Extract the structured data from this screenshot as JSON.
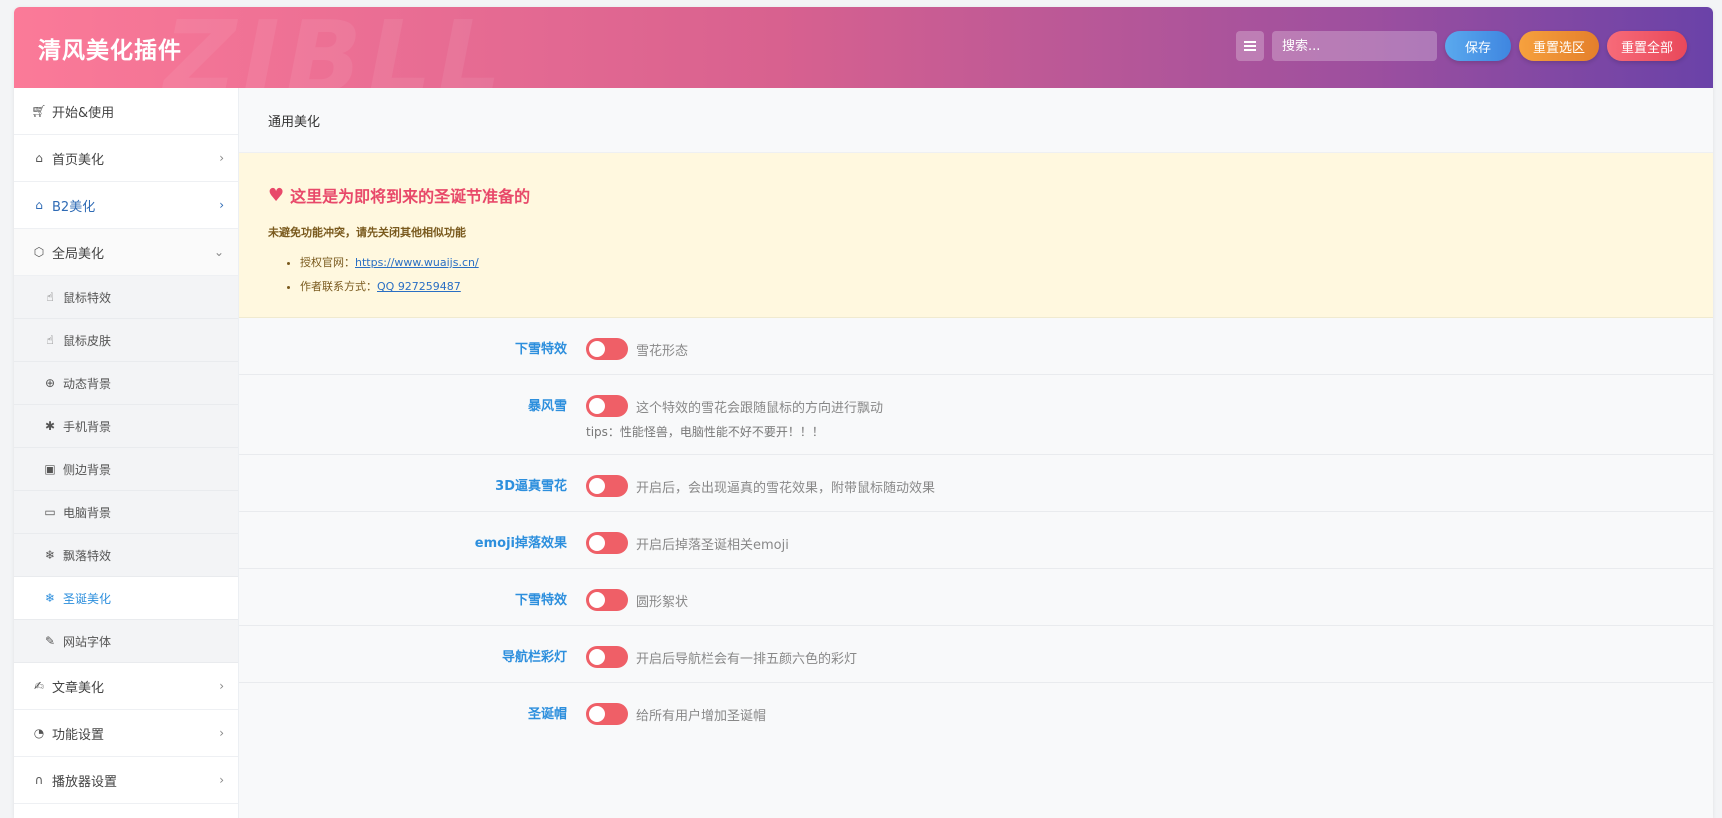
{
  "header": {
    "brand": "清风美化插件",
    "watermark": "ZIBLL",
    "search_placeholder": "搜索...",
    "save_label": "保存",
    "reset_section_label": "重置选区",
    "reset_all_label": "重置全部",
    "gradient": [
      "#fb7a98",
      "#6a42a8"
    ]
  },
  "sidebar": {
    "items": [
      {
        "label": "开始&使用",
        "icon": "cart-icon"
      },
      {
        "label": "首页美化",
        "icon": "home-icon"
      },
      {
        "label": "B2美化",
        "icon": "home-icon"
      },
      {
        "label": "全局美化",
        "icon": "cube-icon"
      }
    ],
    "sub_items": [
      {
        "label": "鼠标特效",
        "icon": "hand-pointer-icon"
      },
      {
        "label": "鼠标皮肤",
        "icon": "hand-pointer-icon"
      },
      {
        "label": "动态背景",
        "icon": "lifebuoy-icon"
      },
      {
        "label": "手机背景",
        "icon": "android-icon"
      },
      {
        "label": "侧边背景",
        "icon": "image-icon"
      },
      {
        "label": "电脑背景",
        "icon": "monitor-icon"
      },
      {
        "label": "飘落特效",
        "icon": "snowflake-icon"
      },
      {
        "label": "圣诞美化",
        "icon": "snowflake-icon"
      },
      {
        "label": "网站字体",
        "icon": "pencil-icon"
      }
    ],
    "bottom_items": [
      {
        "label": "文章美化",
        "icon": "edit-icon"
      },
      {
        "label": "功能设置",
        "icon": "pie-chart-icon"
      },
      {
        "label": "播放器设置",
        "icon": "headphones-icon"
      }
    ]
  },
  "main": {
    "section_title": "通用美化",
    "notice": {
      "title": "这里是为即将到来的圣诞节准备的",
      "subtitle": "未避免功能冲突，请先关闭其他相似功能",
      "line1_prefix": "授权官网：",
      "line1_link": "https://www.wuaijs.cn/",
      "line2_prefix": "作者联系方式：",
      "line2_link": "QQ 927259487"
    },
    "options": [
      {
        "label": "下雪特效",
        "desc": "雪花形态"
      },
      {
        "label": "暴风雪",
        "desc": "这个特效的雪花会跟随鼠标的方向进行飘动",
        "tip": "tips：性能怪兽，电脑性能不好不要开！！！"
      },
      {
        "label": "3D逼真雪花",
        "desc": "开启后，会出现逼真的雪花效果，附带鼠标随动效果"
      },
      {
        "label": "emoji掉落效果",
        "desc": "开启后掉落圣诞相关emoji"
      },
      {
        "label": "下雪特效",
        "desc": "圆形絮状"
      },
      {
        "label": "导航栏彩灯",
        "desc": "开启后导航栏会有一排五颜六色的彩灯"
      },
      {
        "label": "圣诞帽",
        "desc": "给所有用户增加圣诞帽"
      }
    ]
  },
  "colors": {
    "accent_blue": "#2d8fdd",
    "toggle_off": "#ef5f67",
    "notice_bg": "#fff8df",
    "notice_title": "#e8496a"
  }
}
